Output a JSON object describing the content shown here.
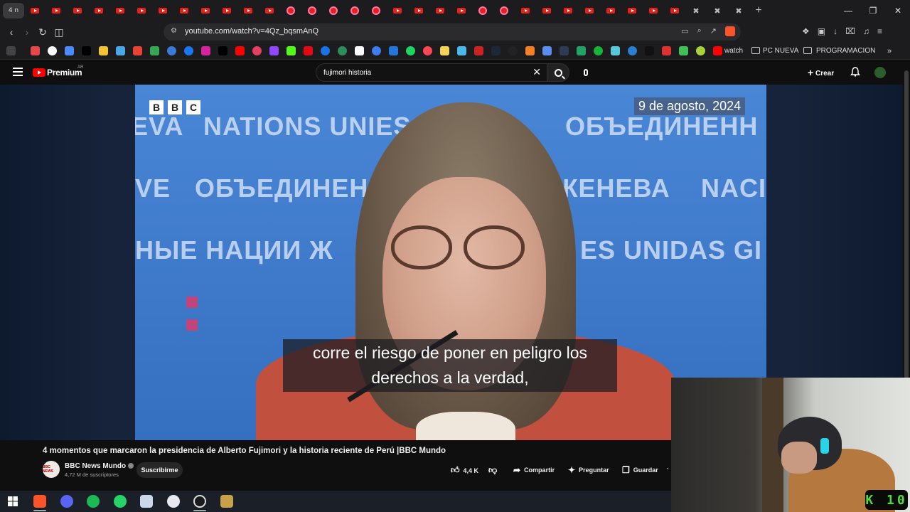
{
  "browser": {
    "tab_count_label": "4 n",
    "url": "youtube.com/watch?v=4Qz_bqsmAnQ",
    "bookmarks": {
      "watch_label": "watch",
      "folder1_label": "PC NUEVA",
      "folder2_label": "PROGRAMACION"
    }
  },
  "youtube": {
    "brand_label": "Premium",
    "region_label": "AR",
    "search_value": "fujimori historia",
    "create_label": "Crear",
    "video": {
      "bbc_letters": [
        "B",
        "B",
        "C"
      ],
      "date_overlay": "9 de agosto, 2024",
      "background_words": [
        "EVA",
        "NATIONS UNIES",
        "VE",
        "ОБЪЕДИНЕНН",
        "VE",
        "ОБЪЕДИНЕН",
        "ЖЕНЕВА",
        "NACI",
        "НЫЕ НАЦИИ Ж",
        "ES UNIDAS GI"
      ],
      "subtitle_line1": "corre el riesgo de poner en peligro los",
      "subtitle_line2": "derechos a la verdad,"
    },
    "title": "4 momentos que marcaron la presidencia de Alberto Fujimori y la historia reciente de Perú |BBC Mundo",
    "channel": {
      "avatar_text": "BBC NEWS",
      "name": "BBC News Mundo",
      "subscribers": "4,72 M de suscriptores",
      "subscribe_label": "Suscribirme"
    },
    "actions": {
      "likes": "4,4 K",
      "share_label": "Compartir",
      "ask_label": "Preguntar",
      "save_label": "Guardar"
    }
  },
  "overlay": {
    "badge_text": "K 10"
  },
  "colors": {
    "youtube_red": "#ff0000",
    "video_bg_blue": "#3f7acb",
    "badge_green": "#4ddc3a"
  }
}
